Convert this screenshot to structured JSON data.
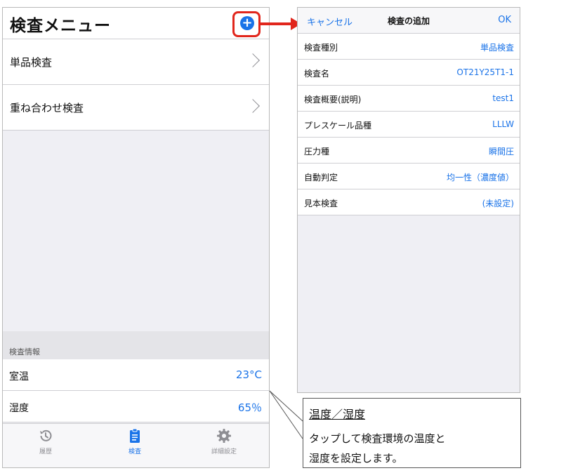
{
  "left": {
    "title": "検査メニュー",
    "add_icon": "plus-circle-icon",
    "menu_items": [
      {
        "label": "単品検査"
      },
      {
        "label": "重ね合わせ検査"
      }
    ],
    "info_header": "検査情報",
    "info_rows": [
      {
        "label": "室温",
        "value": "23°C"
      },
      {
        "label": "湿度",
        "value": "65％"
      }
    ],
    "tabs": [
      {
        "label": "履歴",
        "icon": "history-icon"
      },
      {
        "label": "検査",
        "icon": "clipboard-icon"
      },
      {
        "label": "詳細設定",
        "icon": "gear-icon"
      }
    ]
  },
  "right": {
    "cancel_label": "キャンセル",
    "title": "検査の追加",
    "ok_label": "OK",
    "rows": [
      {
        "label": "検査種別",
        "value": "単品検査"
      },
      {
        "label": "検査名",
        "value": "OT21Y25T1-1"
      },
      {
        "label": "検査概要(説明)",
        "value": "test1"
      },
      {
        "label": "プレスケール品種",
        "value": "LLLW"
      },
      {
        "label": "圧力種",
        "value": "瞬間圧"
      },
      {
        "label": "自動判定",
        "value": "均一性（濃度値）"
      },
      {
        "label": "見本検査",
        "value": "(未設定)"
      }
    ]
  },
  "callout": {
    "title": "温度／湿度",
    "line1": "タップして検査環境の温度と",
    "line2": "湿度を設定します。"
  },
  "colors": {
    "accent": "#1a73e8",
    "highlight": "#e1261c"
  }
}
